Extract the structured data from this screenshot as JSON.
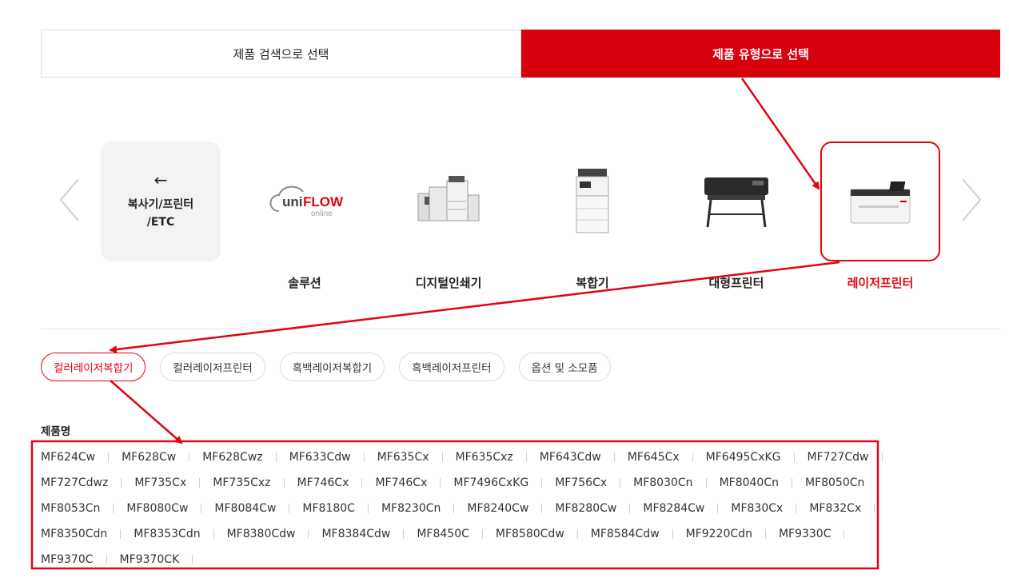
{
  "tabs": [
    {
      "label": "제품 검색으로 선택",
      "active": false
    },
    {
      "label": "제품 유형으로 선택",
      "active": true
    }
  ],
  "carousel": {
    "back": {
      "line1": "복사기/프린터",
      "line2": "/ETC"
    },
    "categories": [
      {
        "label": "솔루션",
        "icon": "uniflow-logo"
      },
      {
        "label": "디지털인쇄기",
        "icon": "digital-press-image"
      },
      {
        "label": "복합기",
        "icon": "multifunction-printer-image"
      },
      {
        "label": "대형프린터",
        "icon": "large-format-printer-image"
      },
      {
        "label": "레이저프린터",
        "icon": "laser-printer-image",
        "selected": true
      }
    ],
    "uniflow_logo": {
      "uni": "uni",
      "flow": "FLOW",
      "online": "online"
    }
  },
  "chips": [
    {
      "label": "컬러레이저복합기",
      "active": true
    },
    {
      "label": "컬러레이저프린터"
    },
    {
      "label": "흑백레이저복합기"
    },
    {
      "label": "흑백레이저프린터"
    },
    {
      "label": "옵션 및 소모품"
    }
  ],
  "products_heading": "제품명",
  "products": [
    "MF624Cw",
    "MF628Cw",
    "MF628Cwz",
    "MF633Cdw",
    "MF635Cx",
    "MF635Cxz",
    "MF643Cdw",
    "MF645Cx",
    "MF6495CxKG",
    "MF727Cdw",
    "MF727Cdwz",
    "MF735Cx",
    "MF735Cxz",
    "MF746Cx",
    "MF746Cx",
    "MF7496CxKG",
    "MF756Cx",
    "MF8030Cn",
    "MF8040Cn",
    "MF8050Cn",
    "MF8053Cn",
    "MF8080Cw",
    "MF8084Cw",
    "MF8180C",
    "MF8230Cn",
    "MF8240Cw",
    "MF8280Cw",
    "MF8284Cw",
    "MF830Cx",
    "MF832Cx",
    "MF8350Cdn",
    "MF8353Cdn",
    "MF8380Cdw",
    "MF8384Cdw",
    "MF8450C",
    "MF8580Cdw",
    "MF8584Cdw",
    "MF9220Cdn",
    "MF9330C",
    "MF9370C",
    "MF9370CK"
  ],
  "colors": {
    "brand_red": "#d7000f",
    "annotation_red": "#e00512"
  }
}
